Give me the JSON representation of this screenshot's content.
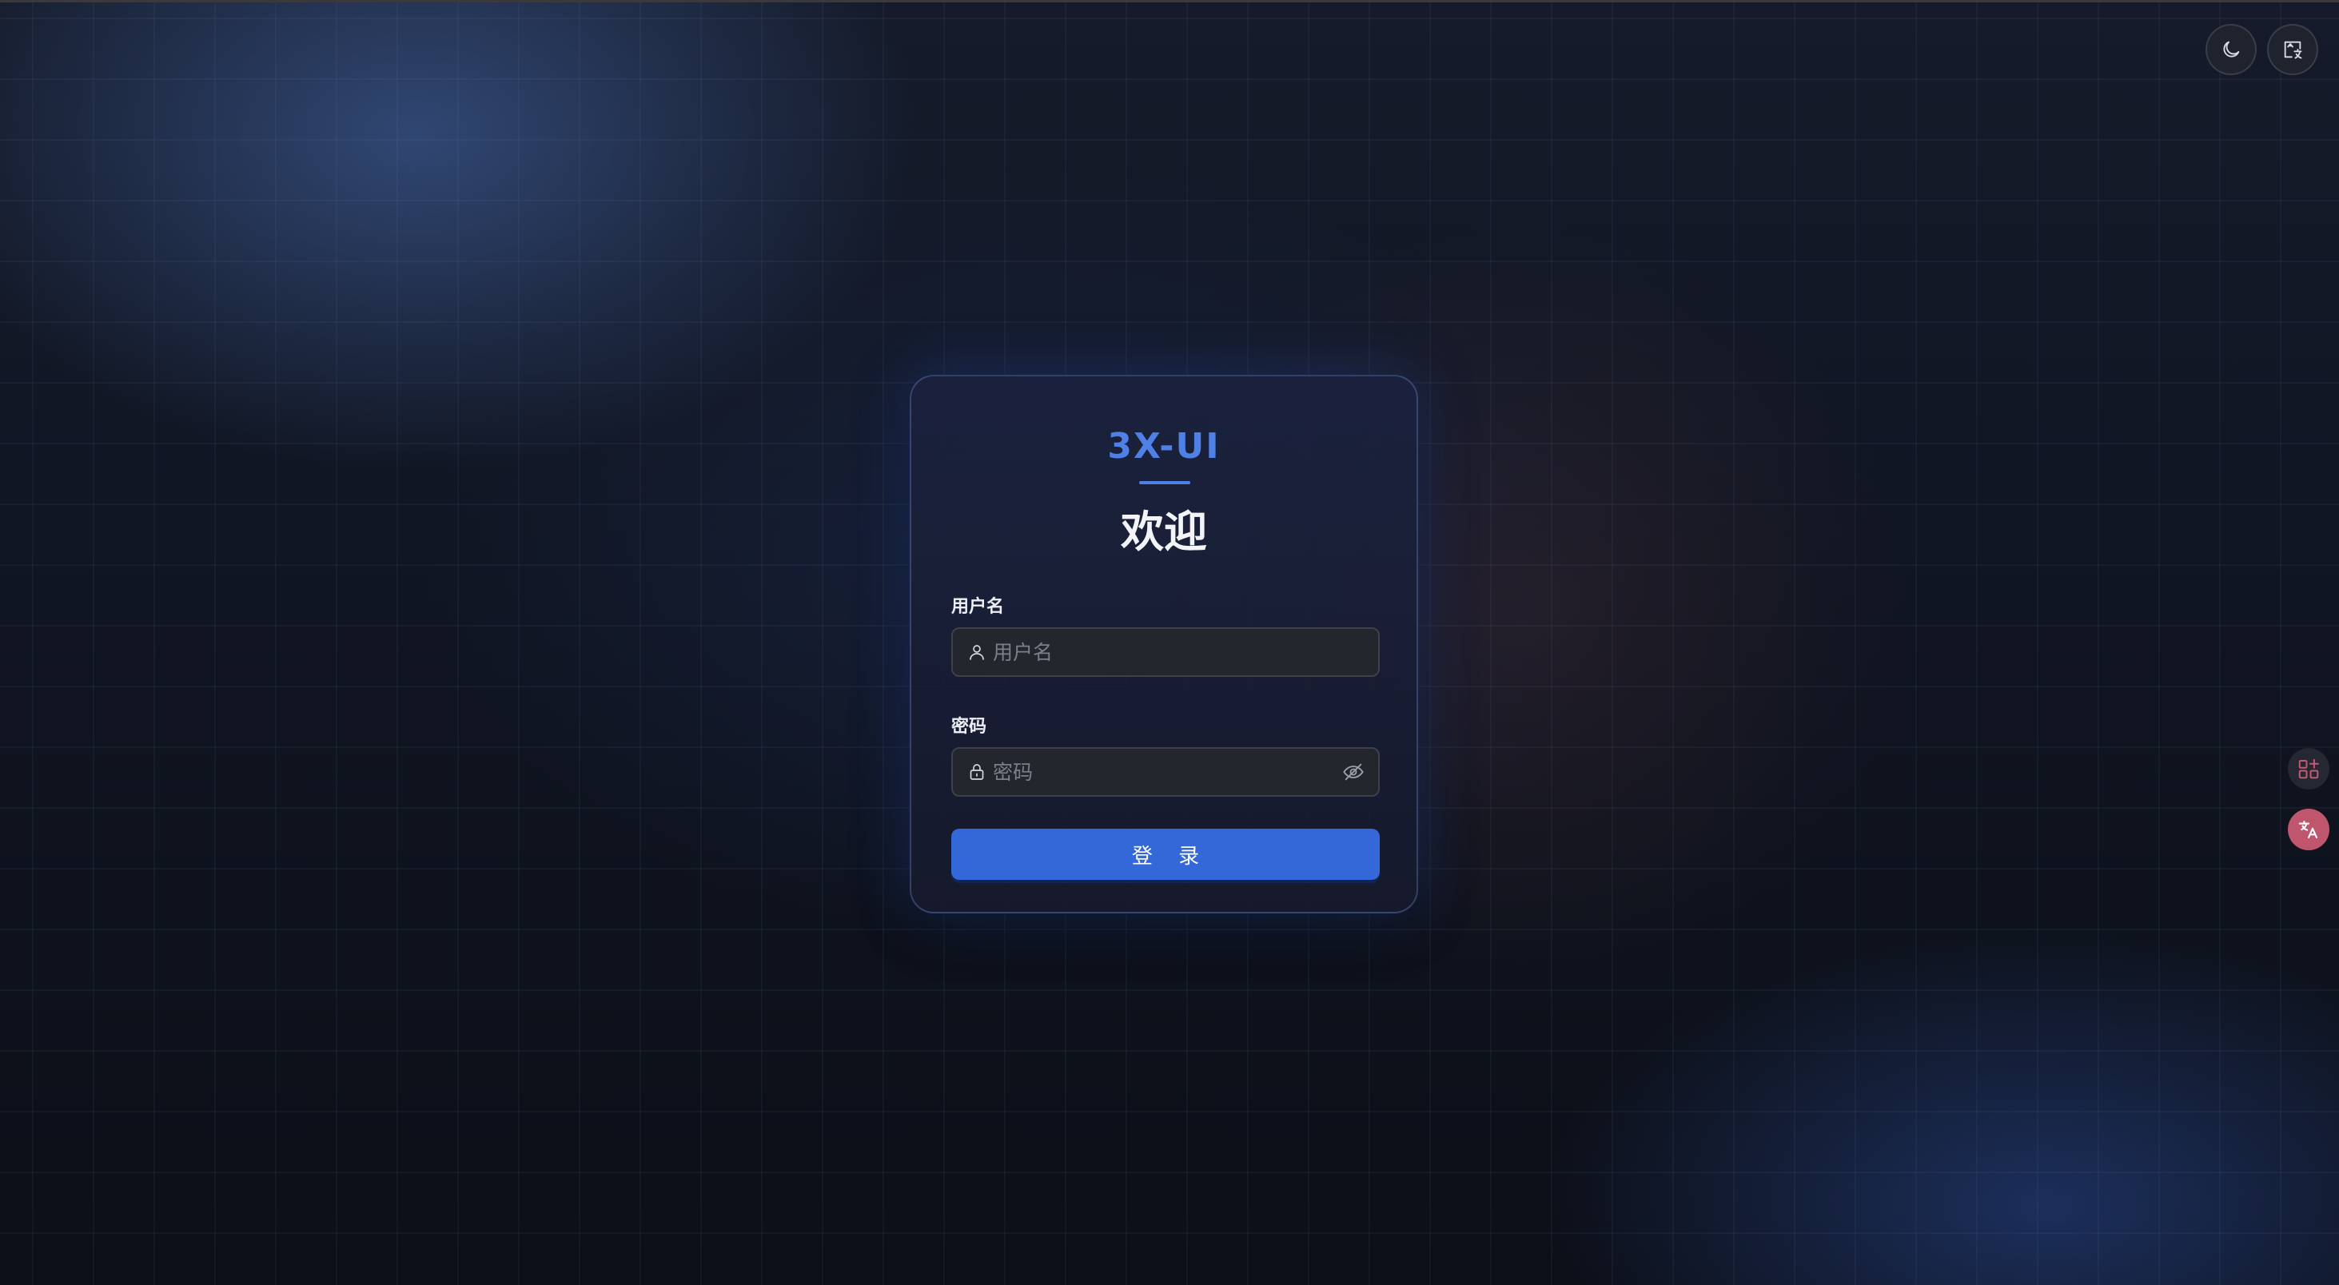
{
  "brand": {
    "name": "3X-UI",
    "accent_color": "#4f80e6"
  },
  "login": {
    "title": "欢迎",
    "username_label": "用户名",
    "username_placeholder": "用户名",
    "username_value": "",
    "password_label": "密码",
    "password_placeholder": "密码",
    "password_value": "",
    "submit_label": "登 录",
    "button_color": "#3468d8"
  },
  "icons": {
    "theme": "moon-icon",
    "language": "image-translate-icon",
    "username": "user-icon",
    "password": "lock-icon",
    "password_toggle": "eye-off-icon",
    "side_apps": "apps-add-icon",
    "side_translate": "translate-icon"
  }
}
